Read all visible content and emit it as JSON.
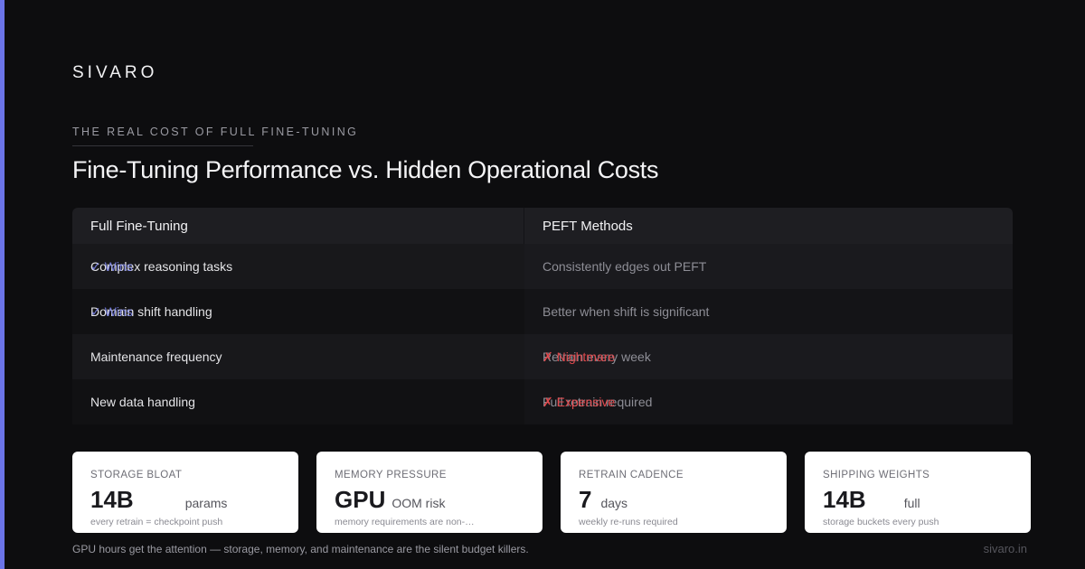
{
  "brand": "SIVARO",
  "eyebrow": "THE REAL COST OF FULL FINE-TUNING",
  "title": "Fine-Tuning Performance vs. Hidden Operational Costs",
  "table": {
    "headers": [
      "Full Fine-Tuning",
      "PEFT Methods"
    ],
    "rows": [
      {
        "left": "Complex reasoning tasks",
        "left_badge": "✓ Wins",
        "right": "Consistently edges out PEFT",
        "right_badge": ""
      },
      {
        "left": "Domain shift handling",
        "left_badge": "✓ Wins",
        "right": "Better when shift is significant",
        "right_badge": ""
      },
      {
        "left": "Maintenance frequency",
        "left_badge": "",
        "right": "Retrain every week",
        "right_badge": "✗ Nightmare"
      },
      {
        "left": "New data handling",
        "left_badge": "",
        "right": "Full retrain required",
        "right_badge": "✗ Expensive"
      }
    ]
  },
  "cards": [
    {
      "label": "STORAGE BLOAT",
      "value": "14B",
      "unit": "params",
      "sub": "every retrain = checkpoint push"
    },
    {
      "label": "MEMORY PRESSURE",
      "value": "GPU",
      "unit": "OOM risk",
      "sub": "memory requirements are non-…"
    },
    {
      "label": "RETRAIN CADENCE",
      "value": "7",
      "unit": "days",
      "sub": "weekly re-runs required"
    },
    {
      "label": "SHIPPING WEIGHTS",
      "value": "14B",
      "unit": "full",
      "sub": "storage buckets every push"
    }
  ],
  "footer": {
    "note": "GPU hours get the attention — storage, memory, and maintenance are the silent budget killers.",
    "domain": "sivaro.in"
  },
  "colors": {
    "accent": "#6b74e8",
    "win": "#7d86f0",
    "bad": "#e0484c",
    "background": "#0d0d0f"
  }
}
